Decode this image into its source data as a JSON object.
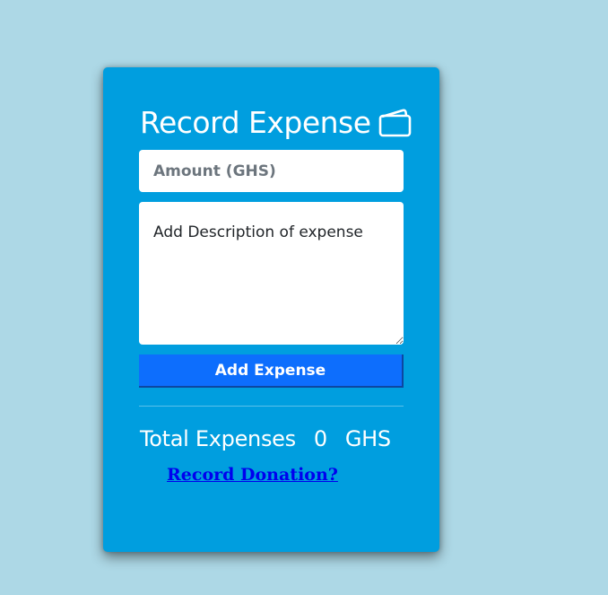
{
  "page": {
    "background_color": "#add8e6"
  },
  "card": {
    "background_color": "#009edf",
    "title": "Record Expense",
    "title_icon": "wallet-icon"
  },
  "form": {
    "amount_placeholder": "Amount (GHS)",
    "description_placeholder": "Add Description of expense",
    "add_button_label": "Add Expense",
    "button_color": "#0d6efd"
  },
  "summary": {
    "total_label": "Total Expenses",
    "total_value": "0",
    "currency": "GHS"
  },
  "links": {
    "record_donation": "Record Donation?"
  }
}
